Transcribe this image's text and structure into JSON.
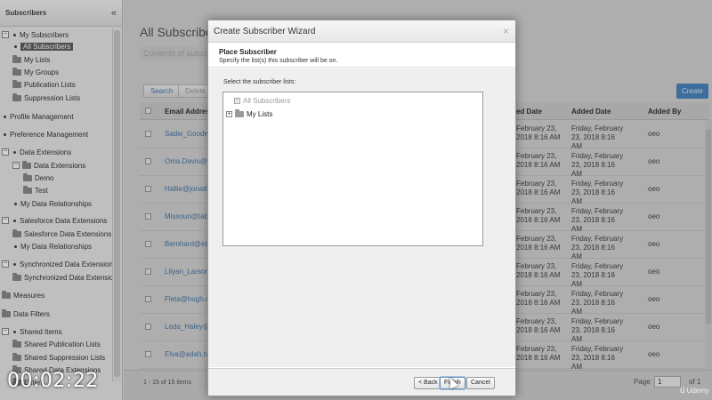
{
  "sidebar": {
    "title": "Subscribers",
    "tree": [
      {
        "label": "My Subscribers",
        "kind": "toggle-bullet",
        "toggle": "−",
        "level": 0
      },
      {
        "label": "All Subscribers",
        "kind": "bullet",
        "level": 1,
        "selected": true
      },
      {
        "label": "My Lists",
        "kind": "folder",
        "level": 1
      },
      {
        "label": "My Groups",
        "kind": "folder",
        "level": 1
      },
      {
        "label": "Publication Lists",
        "kind": "folder",
        "level": 1
      },
      {
        "label": "Suppression Lists",
        "kind": "folder",
        "level": 1
      },
      {
        "label": "Profile Management",
        "kind": "bullet",
        "level": 0
      },
      {
        "label": "Preference Management",
        "kind": "bullet",
        "level": 0
      },
      {
        "label": "Data Extensions",
        "kind": "toggle-bullet",
        "toggle": "−",
        "level": 0
      },
      {
        "label": "Data Extensions",
        "kind": "toggle-folder",
        "toggle": "−",
        "level": 1
      },
      {
        "label": "Demo",
        "kind": "folder",
        "level": 2
      },
      {
        "label": "Test",
        "kind": "folder",
        "level": 2
      },
      {
        "label": "My Data Relationships",
        "kind": "bullet",
        "level": 1
      },
      {
        "label": "Salesforce Data Extensions",
        "kind": "toggle-bullet",
        "toggle": "−",
        "level": 0
      },
      {
        "label": "Salesforce Data Extensions",
        "kind": "folder",
        "level": 1
      },
      {
        "label": "My Data Relationships",
        "kind": "bullet",
        "level": 1
      },
      {
        "label": "Synchronized Data Extensions",
        "kind": "toggle-bullet",
        "toggle": "−",
        "level": 0
      },
      {
        "label": "Synchronized Data Extensions",
        "kind": "folder",
        "level": 1
      },
      {
        "label": "Measures",
        "kind": "folder",
        "level": 0
      },
      {
        "label": "Data Filters",
        "kind": "folder",
        "level": 0
      },
      {
        "label": "Shared Items",
        "kind": "toggle-bullet",
        "toggle": "−",
        "level": 0
      },
      {
        "label": "Shared Publication Lists",
        "kind": "folder",
        "level": 1
      },
      {
        "label": "Shared Suppression Lists",
        "kind": "folder",
        "level": 1
      },
      {
        "label": "Shared Data Extensions",
        "kind": "folder",
        "level": 1
      },
      {
        "label": "Exten",
        "kind": "folder",
        "level": 1
      }
    ]
  },
  "main": {
    "title": "All Subscribers",
    "subtitle": "Contents of subscri",
    "toolbar": {
      "search_label": "Search",
      "delete_label": "Delete",
      "create_label": "Create"
    },
    "columns": {
      "email": "Email Address",
      "created": "ed Date",
      "added": "Added Date",
      "added_by": "Added By"
    },
    "rows": [
      {
        "email": "Sadie_Goodwin@",
        "created": "February 23, 2018 8:16 AM",
        "added": "Friday, February 23, 2018 8:16 AM",
        "added_by": "oeo"
      },
      {
        "email": "Oma.Davis@ter",
        "created": "February 23, 2018 8:16 AM",
        "added": "Friday, February 23, 2018 8:16 AM",
        "added_by": "oeo"
      },
      {
        "email": "Hallie@jonathan",
        "created": "February 23, 2018 8:16 AM",
        "added": "Friday, February 23, 2018 8:16 AM",
        "added_by": "oeo"
      },
      {
        "email": "Missouri@tabitha",
        "created": "February 23, 2018 8:16 AM",
        "added": "Friday, February 23, 2018 8:16 AM",
        "added_by": "oeo"
      },
      {
        "email": "Bernhard@elroy",
        "created": "February 23, 2018 8:16 AM",
        "added": "Friday, February 23, 2018 8:16 AM",
        "added_by": "oeo"
      },
      {
        "email": "Lilyan_Larson@",
        "created": "February 23, 2018 8:16 AM",
        "added": "Friday, February 23, 2018 8:16 AM",
        "added_by": "oeo"
      },
      {
        "email": "Fleta@hugh.org",
        "created": "February 23, 2018 8:16 AM",
        "added": "Friday, February 23, 2018 8:16 AM",
        "added_by": "oeo"
      },
      {
        "email": "Leda_Haley@bro",
        "created": "February 23, 2018 8:16 AM",
        "added": "Friday, February 23, 2018 8:16 AM",
        "added_by": "oeo"
      },
      {
        "email": "Elva@adah.tv",
        "created": "February 23, 2018 8:16 AM",
        "added": "Friday, February 23, 2018 8:16 AM",
        "added_by": "oeo"
      }
    ],
    "pager": {
      "info": "1 - 15 of 15 items",
      "page_label": "Page",
      "page_value": "1",
      "of_label": "of 1"
    }
  },
  "dialog": {
    "title": "Create Subscriber Wizard",
    "close_glyph": "×",
    "step_title": "Place Subscriber",
    "step_desc": "Specify the list(s) this subscriber will be on.",
    "list_label": "Select the subscriber lists:",
    "lists": [
      {
        "label": "All Subscribers",
        "checked": true,
        "disabled": true
      },
      {
        "label": "My Lists",
        "expandable": true
      }
    ],
    "buttons": {
      "back": "< Back",
      "finish": "Finish",
      "cancel": "Cancel"
    }
  },
  "video": {
    "timecode": "00:02:22",
    "watermark": "Udemy"
  },
  "colors": {
    "accent": "#4a86c0",
    "selected_bg": "#616161",
    "link": "#4a78a8"
  }
}
